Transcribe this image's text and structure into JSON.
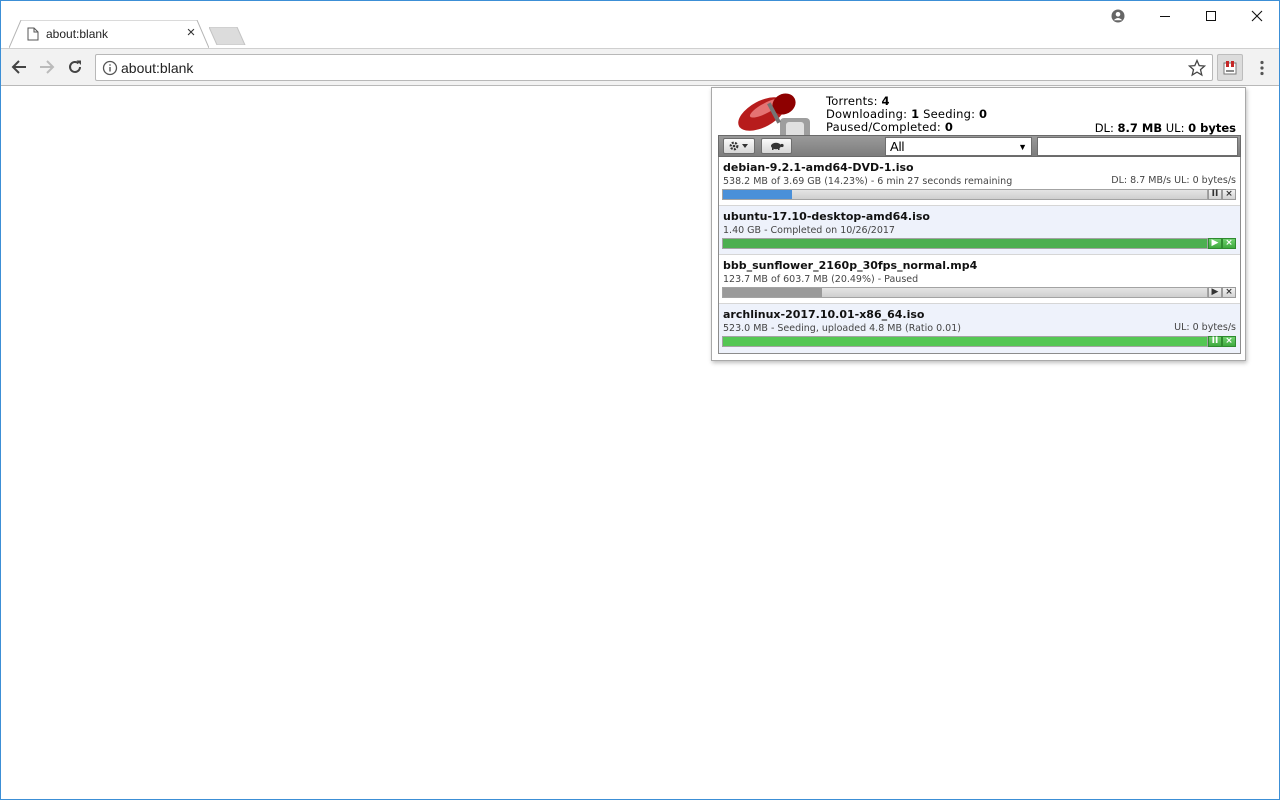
{
  "tab": {
    "title": "about:blank",
    "close_glyph": "×"
  },
  "omnibox": {
    "url": "about:blank"
  },
  "icons": {
    "favicon": "page-icon",
    "back": "back-arrow-icon",
    "forward": "forward-arrow-icon",
    "reload": "reload-icon",
    "info": "info-icon",
    "star": "star-icon",
    "extension": "transmission-extension-icon",
    "menu": "kebab-menu-icon",
    "account": "account-icon",
    "minimize": "minimize-icon",
    "maximize": "maximize-icon",
    "close": "close-icon"
  },
  "popup": {
    "stats": {
      "torrents_label": "Torrents:",
      "torrents": "4",
      "downloading_label": "Downloading:",
      "downloading": "1",
      "seeding_label": "Seeding:",
      "seeding": "0",
      "paused_label": "Paused/Completed:",
      "paused": "0"
    },
    "totals": {
      "dl_label": "DL:",
      "dl": "8.7 MB",
      "ul_label": "UL:",
      "ul": "0 bytes"
    },
    "filter": {
      "selected": "All"
    },
    "torrents": [
      {
        "name": "debian-9.2.1-amd64-DVD-1.iso",
        "status": "538.2 MB of 3.69 GB (14.23%) - 6 min 27 seconds remaining",
        "rate": "DL: 8.7 MB/s UL: 0 bytes/s",
        "progress": 0.1423,
        "state": "downloading",
        "bar_color": "#4a90d9",
        "action": "pause"
      },
      {
        "name": "ubuntu-17.10-desktop-amd64.iso",
        "status": "1.40 GB - Completed on 10/26/2017",
        "rate": "",
        "progress": 1.0,
        "state": "completed",
        "bar_color": "#4caf50",
        "action": "resume"
      },
      {
        "name": "bbb_sunflower_2160p_30fps_normal.mp4",
        "status": "123.7 MB of 603.7 MB (20.49%) - Paused",
        "rate": "",
        "progress": 0.2049,
        "state": "paused",
        "bar_color": "#9a9a9a",
        "action": "resume"
      },
      {
        "name": "archlinux-2017.10.01-x86_64.iso",
        "status": "523.0 MB - Seeding, uploaded 4.8 MB (Ratio 0.01)",
        "rate": "UL: 0 bytes/s",
        "progress": 1.0,
        "state": "seeding",
        "bar_color": "#54c754",
        "action": "pause"
      }
    ]
  }
}
